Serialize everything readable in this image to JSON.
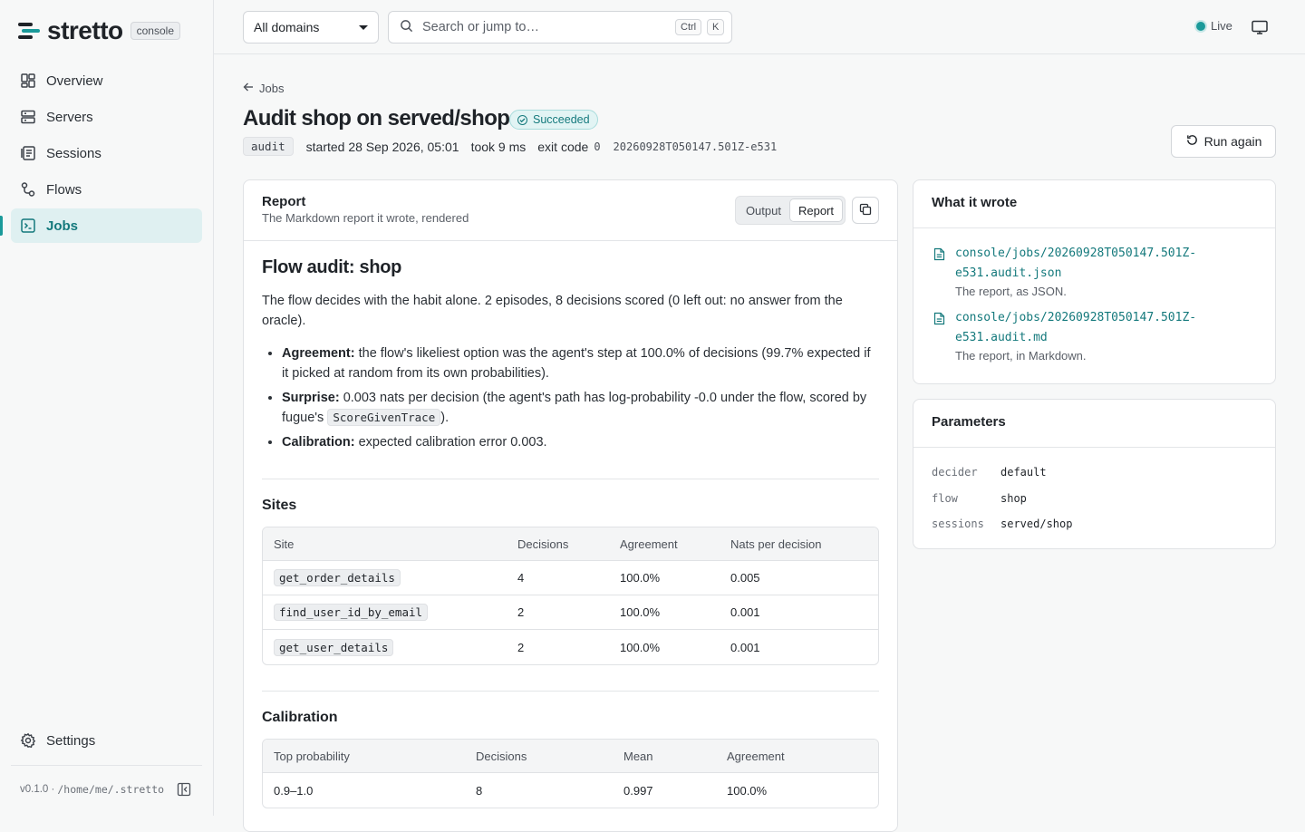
{
  "brand": {
    "name": "stretto",
    "tag": "console"
  },
  "nav": {
    "items": [
      {
        "label": "Overview",
        "icon": "grid-icon"
      },
      {
        "label": "Servers",
        "icon": "server-icon"
      },
      {
        "label": "Sessions",
        "icon": "sessions-icon"
      },
      {
        "label": "Flows",
        "icon": "flows-icon"
      },
      {
        "label": "Jobs",
        "icon": "terminal-icon",
        "active": true
      }
    ],
    "settings": "Settings"
  },
  "footer": {
    "version": "v0.1.0 · ",
    "path": "/home/me/.stretto"
  },
  "topbar": {
    "domain": "All domains",
    "search_placeholder": "Search or jump to…",
    "kbd_ctrl": "Ctrl",
    "kbd_k": "K",
    "live": "Live"
  },
  "job": {
    "back": "Jobs",
    "title": "Audit shop on served/shop",
    "status": "Succeeded",
    "kind": "audit",
    "started": "started 28 Sep 2026, 05:01",
    "took": "took 9 ms",
    "exit_label": "exit code",
    "exit_code": "0",
    "id": "20260928T050147.501Z-e531",
    "run_again": "Run again"
  },
  "report": {
    "heading": "Report",
    "subheading": "The Markdown report it wrote, rendered",
    "tabs": [
      "Output",
      "Report"
    ],
    "active_tab": "Report",
    "h1": "Flow audit: shop",
    "intro": "The flow decides with the habit alone. 2 episodes, 8 decisions scored (0 left out: no answer from the oracle).",
    "bullets": {
      "agreement_label": "Agreement:",
      "agreement_text": " the flow's likeliest option was the agent's step at 100.0% of decisions (99.7% expected if it picked at random from its own probabilities).",
      "surprise_label": "Surprise:",
      "surprise_text": " 0.003 nats per decision (the agent's path has log-probability -0.0 under the flow, scored by fugue's ",
      "surprise_code": "ScoreGivenTrace",
      "surprise_end": ").",
      "calibration_label": "Calibration:",
      "calibration_text": " expected calibration error 0.003."
    },
    "sites": {
      "heading": "Sites",
      "columns": [
        "Site",
        "Decisions",
        "Agreement",
        "Nats per decision"
      ],
      "rows": [
        [
          "get_order_details",
          "4",
          "100.0%",
          "0.005"
        ],
        [
          "find_user_id_by_email",
          "2",
          "100.0%",
          "0.001"
        ],
        [
          "get_user_details",
          "2",
          "100.0%",
          "0.001"
        ]
      ]
    },
    "calibration": {
      "heading": "Calibration",
      "columns": [
        "Top probability",
        "Decisions",
        "Mean",
        "Agreement"
      ],
      "rows": [
        [
          "0.9–1.0",
          "8",
          "0.997",
          "100.0%"
        ]
      ]
    }
  },
  "wrote": {
    "heading": "What it wrote",
    "files": [
      {
        "path_1": "console/jobs/20260928T050147.501Z-",
        "path_2": "e531.audit.json",
        "desc": "The report, as JSON."
      },
      {
        "path_1": "console/jobs/20260928T050147.501Z-",
        "path_2": "e531.audit.md",
        "desc": "The report, in Markdown."
      }
    ]
  },
  "params": {
    "heading": "Parameters",
    "rows": [
      {
        "k": "decider",
        "v": "default"
      },
      {
        "k": "flow",
        "v": "shop"
      },
      {
        "k": "sessions",
        "v": "served/shop"
      }
    ]
  },
  "colors": {
    "accent": "#1b9a9a",
    "accent_dark": "#14797c",
    "active_bg": "#dff0f1"
  }
}
